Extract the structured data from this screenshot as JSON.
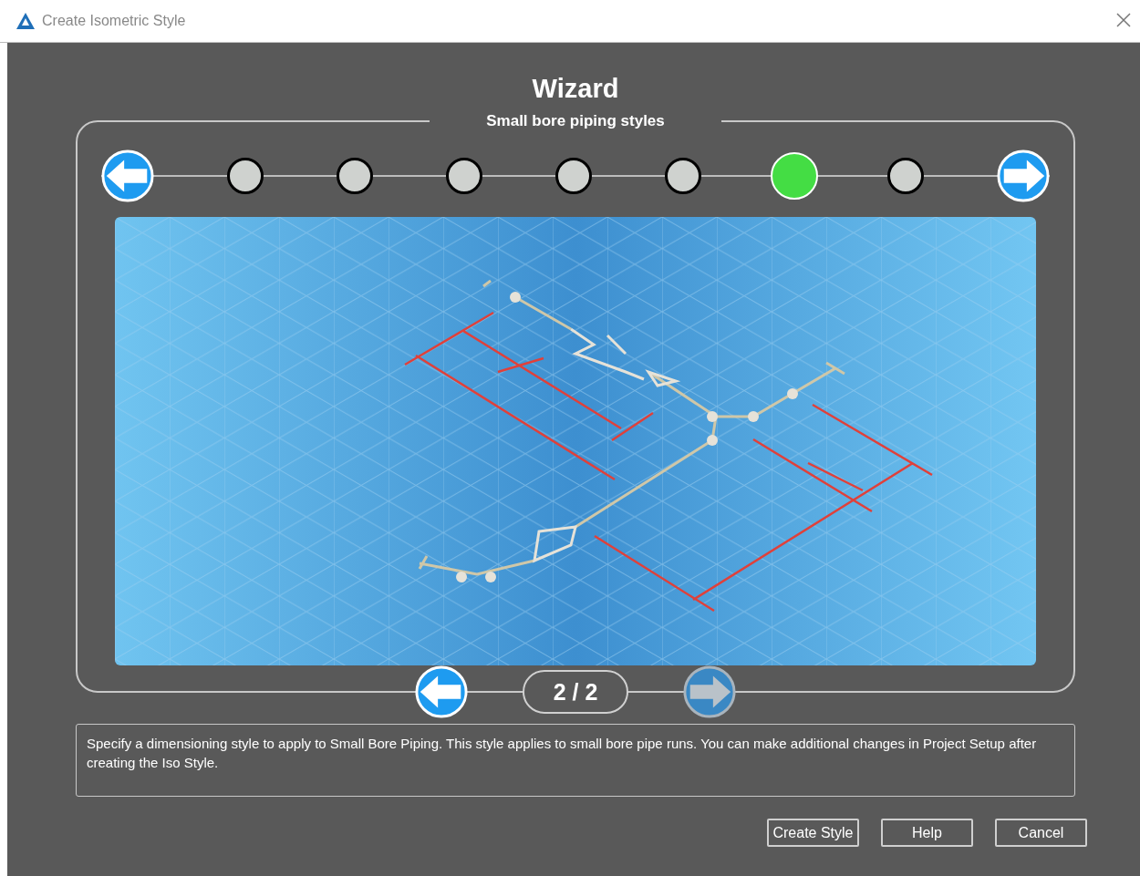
{
  "window": {
    "title": "Create Isometric Style"
  },
  "wizard": {
    "title": "Wizard",
    "section_title": "Small bore piping styles"
  },
  "steps": [
    {
      "selected": false
    },
    {
      "selected": false
    },
    {
      "selected": false
    },
    {
      "selected": false
    },
    {
      "selected": false
    },
    {
      "selected": true
    },
    {
      "selected": false
    }
  ],
  "pager": {
    "label": "2 / 2",
    "previous_disabled": false,
    "next_disabled": true
  },
  "description": "Specify a dimensioning style to apply to Small Bore Piping. This style applies to small bore pipe runs. You can make additional changes in Project Setup after creating the Iso Style.",
  "buttons": [
    "Create Style",
    "Help",
    "Cancel"
  ]
}
